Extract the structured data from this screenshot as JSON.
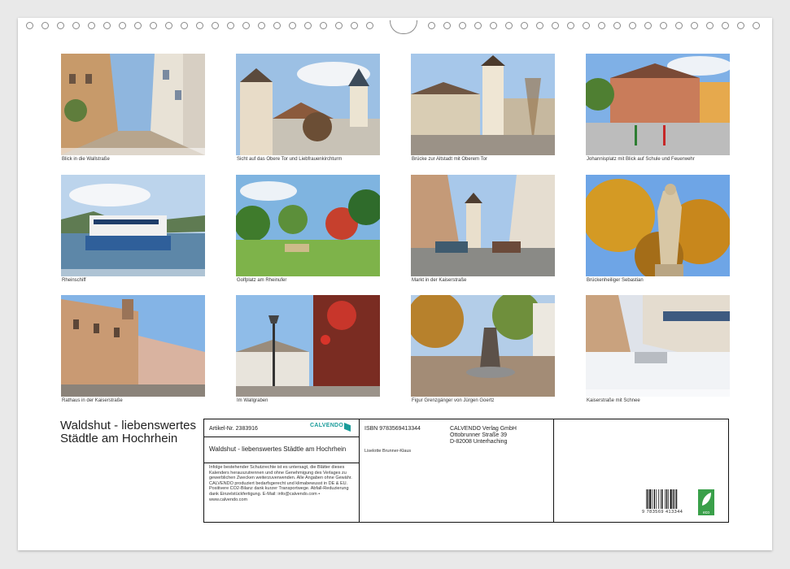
{
  "captions": [
    "Blick in die Wallstraße",
    "Sicht auf das Obere Tor und Liebfrauenkirchturm",
    "Brücke zur Altstadt mit Oberem Tor",
    "Johannisplatz mit Blick auf Schule und Feuerwehr",
    "Rheinschiff",
    "Golfplatz am Rheinufer",
    "Markt in der Kaiserstraße",
    "Brückenheiliger Sebastian",
    "Rathaus in der Kaiserstraße",
    "Im Wallgraben",
    "Figur Grenzgänger von Jürgen Goertz",
    "Kaiserstraße mit Schnee"
  ],
  "calendar_title": "Waldshut - liebenswertes Städtle am Hochrhein",
  "info": {
    "article_no": "Artikel-Nr. 2383916",
    "publisher_logo": "CALVENDO",
    "subtitle": "Waldshut - liebenswertes Städtle am Hochrhein",
    "legal": "Infolge bestehender Schutzrechte ist es untersagt, die Blätter dieses Kalenders herauszutrennen und ohne Genehmigung des Verlages zu gewerblichen Zwecken weiterzuverwenden. Alle Angaben ohne Gewähr. CALVENDO produziert bedarfsgerecht und klimabewusst in DE & EU. Positivere CO2-Bilanz dank kurzer Transportwege. Abfall-Reduzierung dank Einzelstückfertigung. E-Mail: info@calvendo.com • www.calvendo.com",
    "isbn": "ISBN 9783569413344",
    "author": "Liselotte Brunner-Klaus",
    "address_name": "CALVENDO Verlag GmbH",
    "address_street": "Ottobrunner Straße 39",
    "address_city": "D-82008 Unterhaching",
    "barcode_number": "9 783569 413344",
    "eco_label": "eco"
  }
}
